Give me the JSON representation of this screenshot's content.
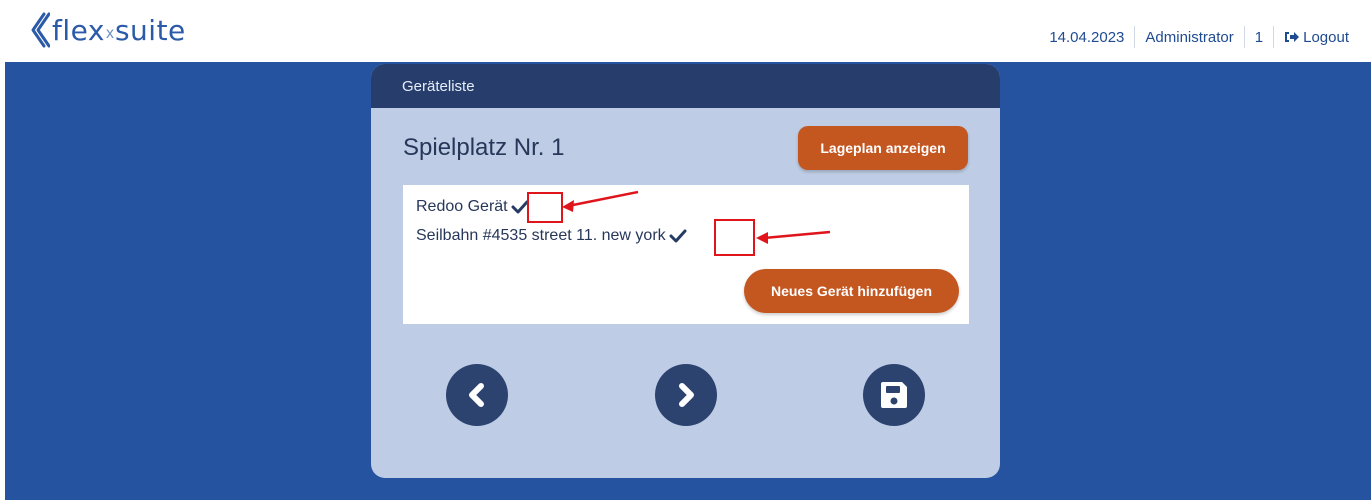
{
  "header": {
    "logo_text_main": "flex",
    "logo_x": "x",
    "logo_text_suite": "suite",
    "date": "14.04.2023",
    "user": "Administrator",
    "count": "1",
    "logout_label": "Logout"
  },
  "panel": {
    "heading": "Geräteliste",
    "title": "Spielplatz Nr. 1",
    "map_button_label": "Lageplan anzeigen",
    "devices": [
      {
        "name": "Redoo Gerät",
        "checked": true
      },
      {
        "name": "Seilbahn #4535 street 11. new york",
        "checked": true
      }
    ],
    "add_button_label": "Neues Gerät hinzufügen"
  },
  "colors": {
    "header_bg": "#ffffff",
    "main_bg": "#2553a0",
    "panel_bg": "#becde5",
    "panel_head_bg": "#273e6d",
    "accent_orange": "#c4561f",
    "nav_button": "#2c4370",
    "annotation_red": "#e0141b"
  },
  "icons": {
    "check": "check-icon",
    "prev": "chevron-left-icon",
    "next": "chevron-right-icon",
    "save": "floppy-disk-icon",
    "logout": "sign-out-icon"
  }
}
